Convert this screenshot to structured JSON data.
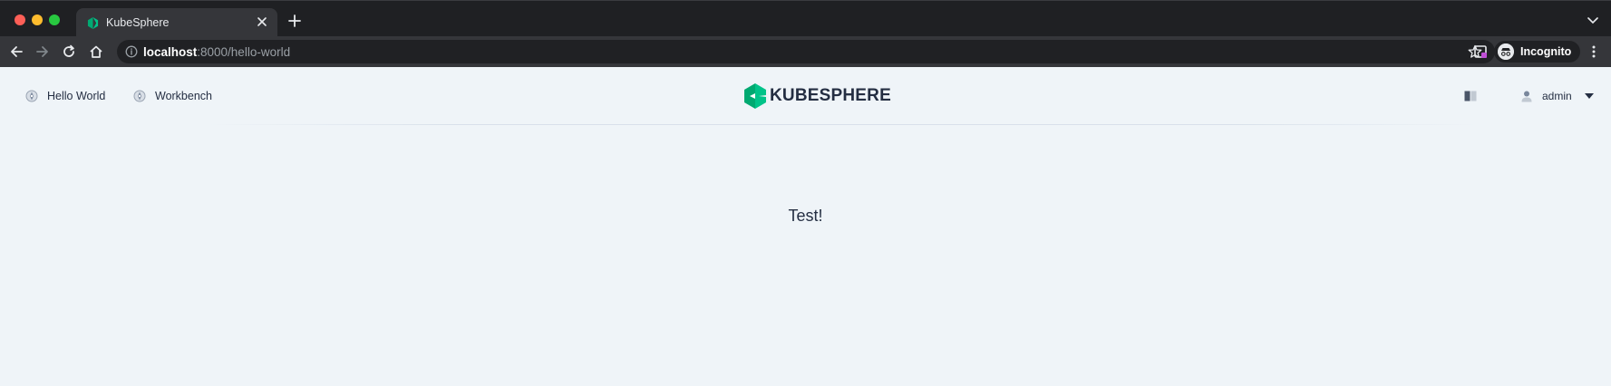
{
  "browser": {
    "tab_title": "KubeSphere",
    "url_host": "localhost",
    "url_path": ":8000/hello-world",
    "profile_label": "Incognito"
  },
  "header": {
    "nav": [
      {
        "label": "Hello World",
        "icon": "compass-icon"
      },
      {
        "label": "Workbench",
        "icon": "compass-icon"
      }
    ],
    "logo_text": "KUBESPHERE",
    "user_name": "admin"
  },
  "main": {
    "message": "Test!"
  },
  "colors": {
    "brand_green": "#00aa72",
    "text_dark": "#242e42",
    "page_bg": "#eff4f8"
  }
}
